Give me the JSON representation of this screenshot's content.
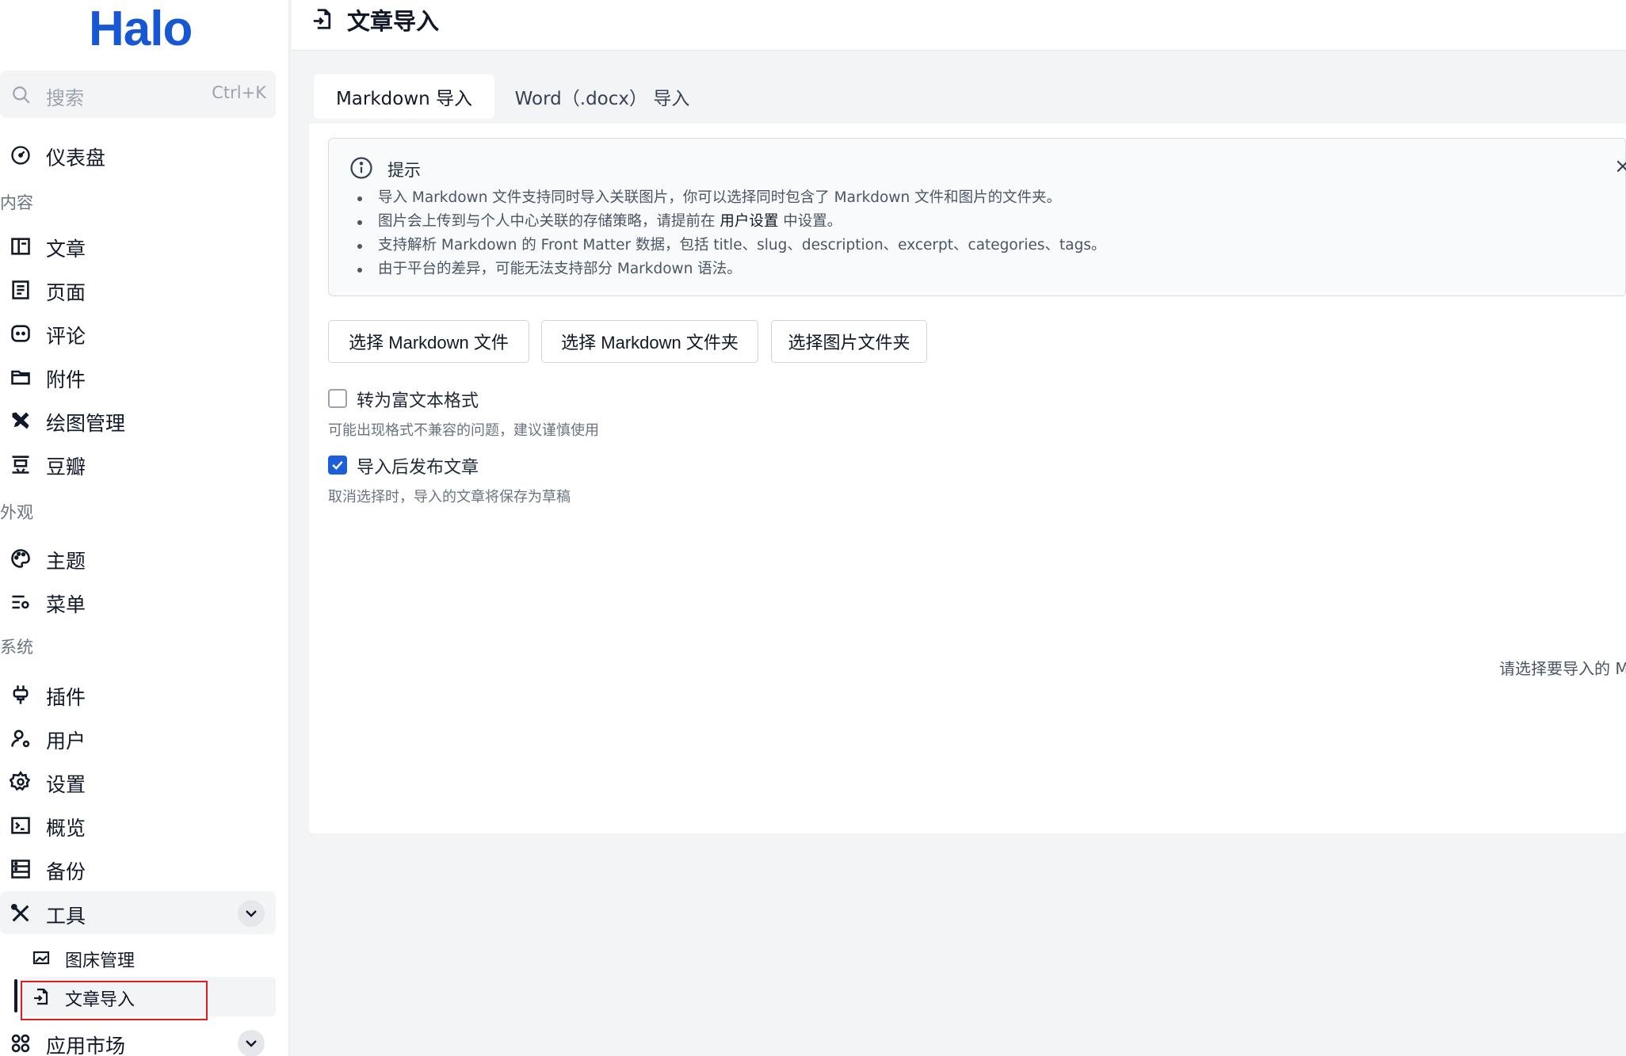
{
  "app": {
    "logo": "Halo"
  },
  "search": {
    "placeholder": "搜索",
    "shortcut": "Ctrl+K"
  },
  "sidebar": {
    "dashboard": "仪表盘",
    "groups": {
      "content": "内容",
      "appearance": "外观",
      "system": "系统"
    },
    "content_items": [
      "文章",
      "页面",
      "评论",
      "附件",
      "绘图管理",
      "豆瓣"
    ],
    "appearance_items": [
      "主题",
      "菜单"
    ],
    "system_items": [
      "插件",
      "用户",
      "设置",
      "概览",
      "备份"
    ],
    "tools": {
      "label": "工具",
      "children": [
        "图床管理",
        "文章导入"
      ]
    },
    "market": "应用市场"
  },
  "page": {
    "title": "文章导入"
  },
  "tabs": [
    "Markdown 导入",
    "Word（.docx） 导入"
  ],
  "alert": {
    "title": "提示",
    "close": "×",
    "items": [
      "导入 Markdown 文件支持同时导入关联图片，你可以选择同时包含了 Markdown 文件和图片的文件夹。",
      "图片会上传到与个人中心关联的存储策略，请提前在",
      "支持解析 Markdown 的 Front Matter 数据，包括 title、slug、description、excerpt、categories、tags。",
      "由于平台的差异，可能无法支持部分 Markdown 语法。"
    ],
    "item2_link": "用户设置",
    "item2_suffix": " 中设置。"
  },
  "buttons": {
    "select_file": "选择 Markdown 文件",
    "select_folder": "选择 Markdown 文件夹",
    "select_image_folder": "选择图片文件夹"
  },
  "options": {
    "rich_text": {
      "label": "转为富文本格式",
      "help": "可能出现格式不兼容的问题，建议谨慎使用",
      "checked": false
    },
    "publish": {
      "label": "导入后发布文章",
      "help": "取消选择时，导入的文章将保存为草稿",
      "checked": true
    }
  },
  "empty": {
    "note": "请选择要导入的 M"
  },
  "colors": {
    "brand": "#1857d3",
    "checkbox": "#1d5fd8",
    "highlight": "#e11d1d"
  }
}
